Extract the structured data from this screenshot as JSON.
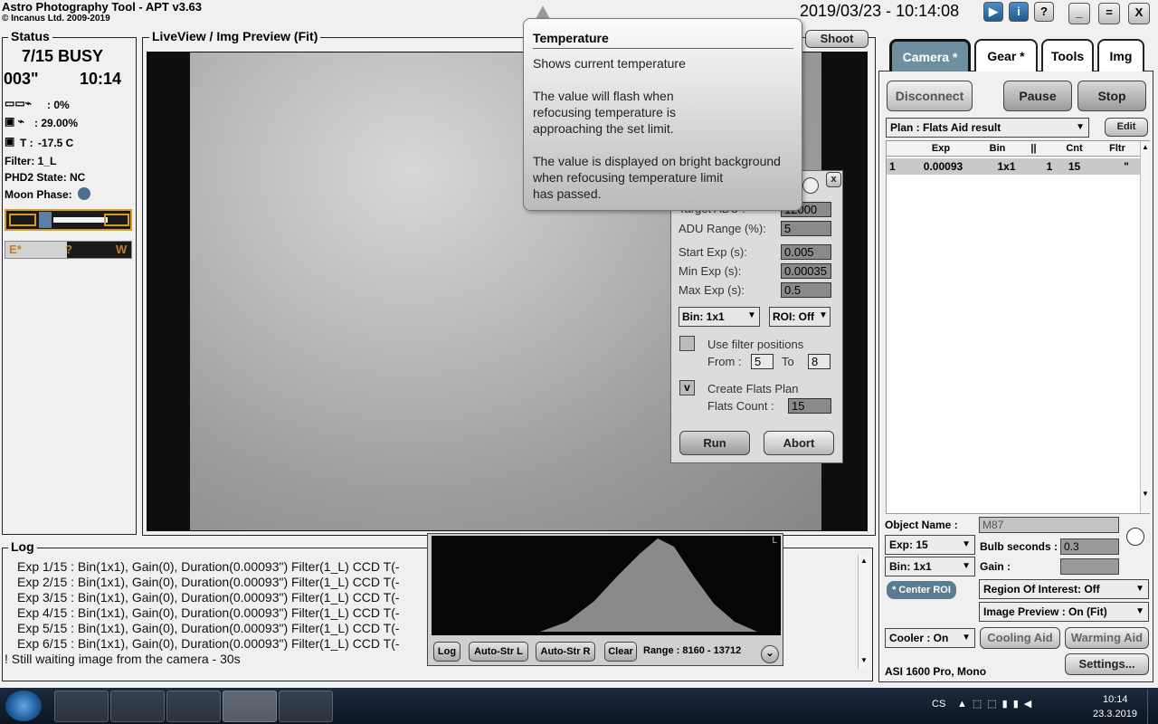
{
  "app": {
    "title": "Astro Photography Tool  -  APT v3.63",
    "copyright": "© Incanus Ltd. 2009-2019",
    "clock": "2019/03/23 - 10:14:08",
    "top_buttons": [
      "▶",
      "i",
      "?",
      "_",
      "=",
      "X"
    ]
  },
  "status": {
    "label": "Status",
    "progress": "7/15 BUSY",
    "exposure": "003\"",
    "time": "10:14",
    "cam1_value": ": 0%",
    "cam2_value": ": 29.00%",
    "temp_label": "T :",
    "temp_value": "-17.5 C",
    "filter": "Filter: 1_L",
    "phd2": "PHD2 State: NC",
    "moon": "Moon Phase:",
    "ew_e": "E*",
    "ew_mid": "?",
    "ew_w": "W"
  },
  "preview": {
    "label": "LiveView / Img Preview (Fit)",
    "shoot": "Shoot"
  },
  "tooltip": {
    "title": "Temperature",
    "text": "Shows current temperature\n\nThe value will flash when\nrefocusing temperature is\napproaching the set limit.\n\nThe value is displayed on bright background\nwhen refocusing temperature limit\nhas passed."
  },
  "flats": {
    "close": "x",
    "target_adu_label": "Target ADU :",
    "target_adu": "12000",
    "adu_range_label": "ADU Range (%):",
    "adu_range": "5",
    "start_exp_label": "Start Exp (s):",
    "start_exp": "0.005",
    "min_exp_label": "Min Exp (s):",
    "min_exp": "0.00035",
    "max_exp_label": "Max Exp (s):",
    "max_exp": "0.5",
    "bin": "Bin: 1x1",
    "roi": "ROI: Off",
    "use_filter_label": "Use filter positions",
    "from_label": "From :",
    "from": "5",
    "to_label": "To",
    "to": "8",
    "create_plan_check": "v",
    "create_plan_label": "Create Flats Plan",
    "flats_count_label": "Flats Count :",
    "flats_count": "15",
    "run": "Run",
    "abort": "Abort"
  },
  "tabs": [
    "Camera *",
    "Gear *",
    "Tools",
    "Img"
  ],
  "camera": {
    "disconnect": "Disconnect",
    "pause": "Pause",
    "stop": "Stop",
    "plan": "Plan : Flats Aid result",
    "edit": "Edit",
    "columns": [
      "",
      "Exp",
      "Bin",
      "||",
      "Cnt",
      "Fltr"
    ],
    "row": [
      "1",
      "0.00093",
      "1x1",
      "1",
      "15",
      "\""
    ],
    "object_label": "Object Name :",
    "object": "M87",
    "exp": "Exp: 15",
    "bulb_label": "Bulb seconds :",
    "bulb": "0.3",
    "bin": "Bin: 1x1",
    "gain_label": "Gain :",
    "gain": "",
    "center_roi": "* Center ROI",
    "roi": "Region Of Interest: Off",
    "img_preview": "Image Preview : On (Fit)",
    "cooler": "Cooler : On",
    "cooling_aid": "Cooling Aid",
    "warming_aid": "Warming Aid",
    "camera_name": "ASI 1600 Pro, Mono",
    "settings": "Settings..."
  },
  "log": {
    "label": "Log",
    "lines": [
      "Exp 1/15 : Bin(1x1), Gain(0), Duration(0.00093\") Filter(1_L) CCD T(-",
      "Exp 2/15 : Bin(1x1), Gain(0), Duration(0.00093\") Filter(1_L) CCD T(-",
      "Exp 3/15 : Bin(1x1), Gain(0), Duration(0.00093\") Filter(1_L) CCD T(-",
      "Exp 4/15 : Bin(1x1), Gain(0), Duration(0.00093\") Filter(1_L) CCD T(-",
      "Exp 5/15 : Bin(1x1), Gain(0), Duration(0.00093\") Filter(1_L) CCD T(-",
      "Exp 6/15 : Bin(1x1), Gain(0), Duration(0.00093\") Filter(1_L) CCD T(-",
      "! Still waiting image from the camera - 30s"
    ]
  },
  "histogram": {
    "corner": "L",
    "log": "Log",
    "auto_l": "Auto-Str L",
    "auto_r": "Auto-Str R",
    "clear": "Clear",
    "range": "Range : 8160 - 13712",
    "expand": "⌄"
  },
  "taskbar": {
    "lang": "CS",
    "time": "10:14",
    "date": "23.3.2019"
  }
}
